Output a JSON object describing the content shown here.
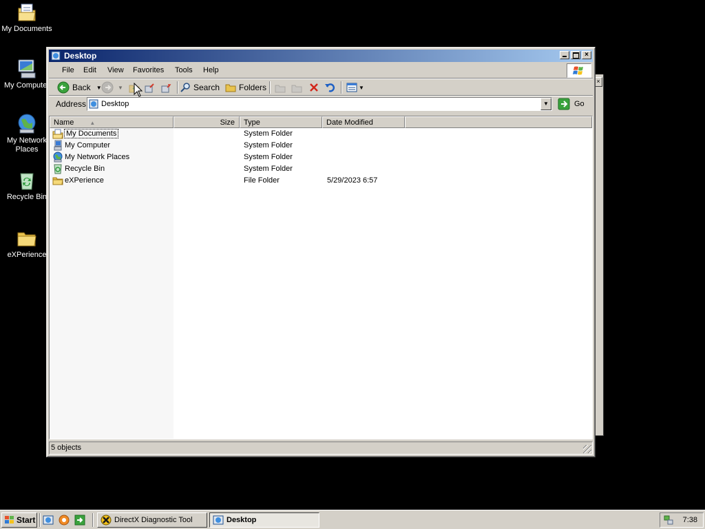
{
  "desktop": {
    "icons": [
      {
        "label": "My Documents",
        "icon": "my-documents-icon"
      },
      {
        "label": "My Compute",
        "icon": "my-computer-icon"
      },
      {
        "label": "My Network Places",
        "icon": "network-places-icon"
      },
      {
        "label": "Recycle Bin",
        "icon": "recycle-bin-icon"
      },
      {
        "label": "eXPerience",
        "icon": "folder-icon"
      }
    ]
  },
  "window": {
    "title": "Desktop",
    "menu": [
      "File",
      "Edit",
      "View",
      "Favorites",
      "Tools",
      "Help"
    ],
    "toolbar": {
      "back_label": "Back",
      "search_label": "Search",
      "folders_label": "Folders"
    },
    "address": {
      "label": "Address",
      "value": "Desktop",
      "go_label": "Go"
    },
    "columns": [
      "Name",
      "Size",
      "Type",
      "Date Modified"
    ],
    "sort": {
      "column": "Name",
      "direction": "ascending"
    },
    "rows": [
      {
        "name": "My Documents",
        "size": "",
        "type": "System Folder",
        "modified": "",
        "icon": "my-documents-icon"
      },
      {
        "name": "My Computer",
        "size": "",
        "type": "System Folder",
        "modified": "",
        "icon": "my-computer-icon"
      },
      {
        "name": "My Network Places",
        "size": "",
        "type": "System Folder",
        "modified": "",
        "icon": "network-places-icon"
      },
      {
        "name": "Recycle Bin",
        "size": "",
        "type": "System Folder",
        "modified": "",
        "icon": "recycle-bin-icon"
      },
      {
        "name": "eXPerience",
        "size": "",
        "type": "File Folder",
        "modified": "5/29/2023 6:57",
        "icon": "folder-icon"
      }
    ],
    "status": "5 objects"
  },
  "taskbar": {
    "start_label": "Start",
    "tasks": [
      {
        "label": "DirectX Diagnostic Tool",
        "active": false
      },
      {
        "label": "Desktop",
        "active": true
      }
    ],
    "clock": "7:38"
  },
  "colors": {
    "desktop_bg": "#000000",
    "titlebar_start": "#0a246a",
    "titlebar_end": "#a6caf0",
    "face": "#d4d0c8"
  }
}
